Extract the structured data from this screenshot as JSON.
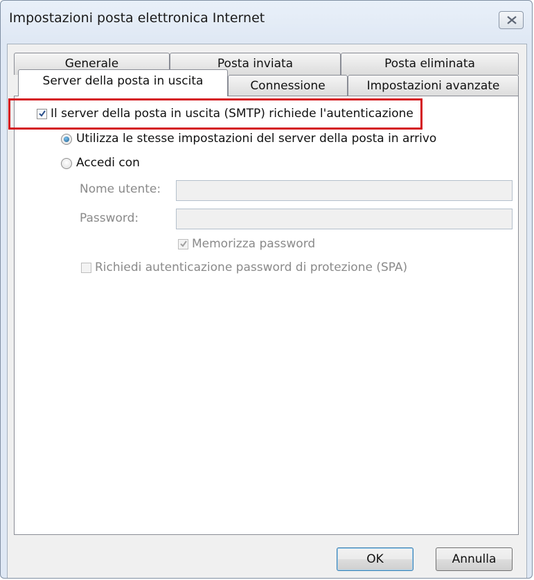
{
  "window": {
    "title": "Impostazioni posta elettronica Internet",
    "close_icon": "close-icon"
  },
  "tabs": {
    "back_row": [
      {
        "label": "Generale"
      },
      {
        "label": "Posta inviata"
      },
      {
        "label": "Posta eliminata"
      }
    ],
    "front_row": [
      {
        "label": "Server della posta in uscita",
        "active": true
      },
      {
        "label": "Connessione",
        "active": false
      },
      {
        "label": "Impostazioni avanzate",
        "active": false
      }
    ]
  },
  "panel": {
    "smtp_auth": {
      "label": "Il server della posta in uscita (SMTP) richiede l'autenticazione",
      "checked": true
    },
    "use_same": {
      "label": "Utilizza le stesse impostazioni del server della posta in arrivo",
      "selected": true
    },
    "login_with": {
      "label": "Accedi con",
      "selected": false
    },
    "username": {
      "label": "Nome utente:",
      "value": ""
    },
    "password": {
      "label": "Password:",
      "value": ""
    },
    "remember_password": {
      "label": "Memorizza password",
      "checked": true,
      "enabled": false
    },
    "spa": {
      "label": "Richiedi autenticazione password di protezione (SPA)",
      "checked": false,
      "enabled": false
    }
  },
  "buttons": {
    "ok": "OK",
    "cancel": "Annulla"
  },
  "colors": {
    "highlight": "#d4141c",
    "disabled_text": "#8a8a8a"
  }
}
